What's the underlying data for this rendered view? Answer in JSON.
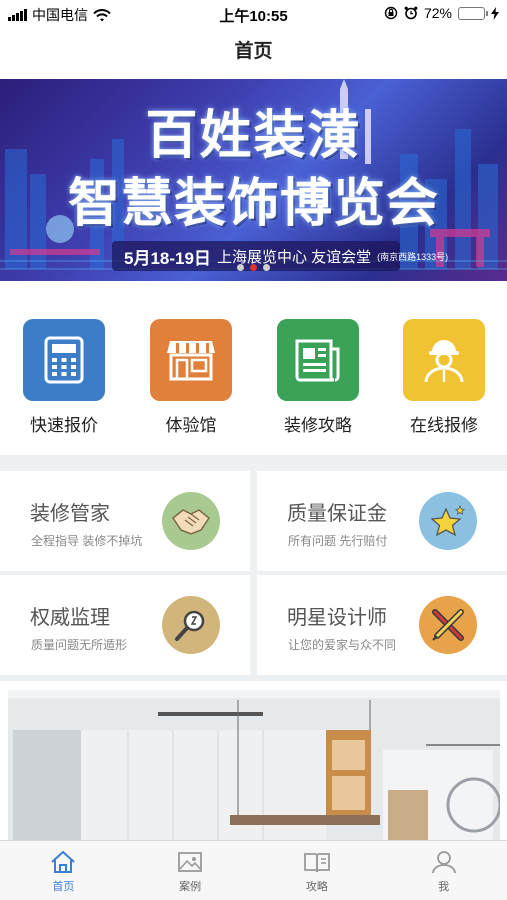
{
  "status_bar": {
    "carrier": "中国电信",
    "time": "上午10:55",
    "battery": "72%",
    "battery_level": 0.72
  },
  "nav": {
    "title": "首页"
  },
  "banner": {
    "title_line1": "百姓装潢",
    "title_line2": "智慧装饰博览会",
    "date": "5月18-19日",
    "venue": "上海展览中心 友谊会堂",
    "address": "(南京西路1333号)",
    "slide_count": 3,
    "active_slide": 2
  },
  "quick_actions": [
    {
      "label": "快速报价",
      "icon": "calculator-icon",
      "color": "#3d7dc8"
    },
    {
      "label": "体验馆",
      "icon": "storefront-icon",
      "color": "#e0803a"
    },
    {
      "label": "装修攻略",
      "icon": "newspaper-icon",
      "color": "#3aa357"
    },
    {
      "label": "在线报修",
      "icon": "worker-icon",
      "color": "#f1c232"
    }
  ],
  "services": [
    {
      "title": "装修管家",
      "subtitle": "全程指导 装修不掉坑",
      "icon": "handshake-icon",
      "color": "#a8c98f"
    },
    {
      "title": "质量保证金",
      "subtitle": "所有问题 先行赔付",
      "icon": "star-icon",
      "color": "#8cc0e0"
    },
    {
      "title": "权威监理",
      "subtitle": "质量问题无所遁形",
      "icon": "magnifier-icon",
      "color": "#d2b57a"
    },
    {
      "title": "明星设计师",
      "subtitle": "让您的爱家与众不同",
      "icon": "pencil-ruler-icon",
      "color": "#e8a24a"
    }
  ],
  "tabs": [
    {
      "label": "首页",
      "icon": "home-icon",
      "active": true
    },
    {
      "label": "案例",
      "icon": "image-icon",
      "active": false
    },
    {
      "label": "攻略",
      "icon": "book-icon",
      "active": false
    },
    {
      "label": "我",
      "icon": "user-icon",
      "active": false
    }
  ],
  "colors": {
    "accent": "#3a7fd5",
    "divider": "#eef1f4"
  }
}
